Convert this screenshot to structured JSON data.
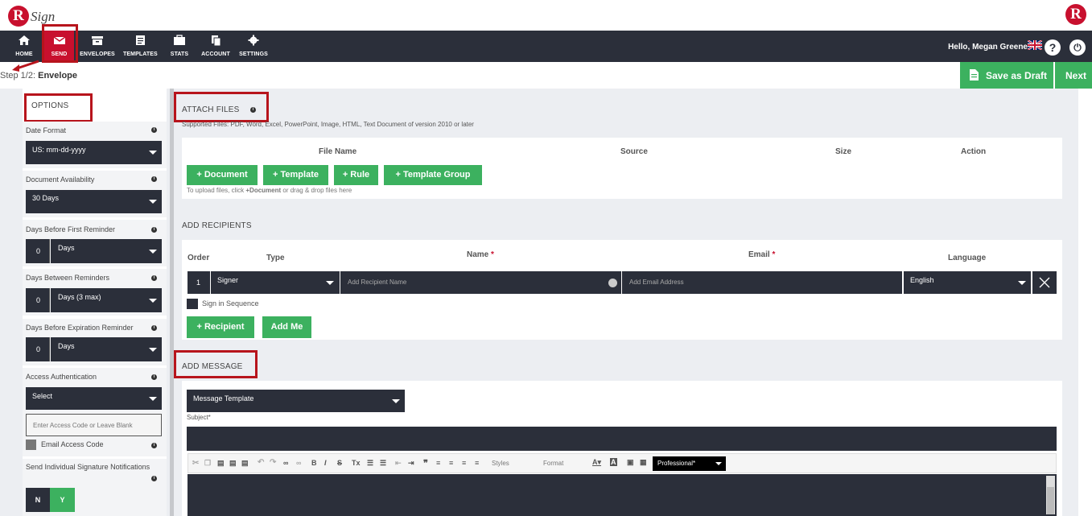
{
  "brand": {
    "logo_letter": "R",
    "logo_word": "Sign"
  },
  "nav": {
    "items": [
      {
        "label": "HOME",
        "icon": "home-icon"
      },
      {
        "label": "SEND",
        "icon": "envelope-icon"
      },
      {
        "label": "ENVELOPES",
        "icon": "envelopes-icon"
      },
      {
        "label": "TEMPLATES",
        "icon": "templates-icon"
      },
      {
        "label": "STATS",
        "icon": "stats-icon"
      },
      {
        "label": "ACCOUNT",
        "icon": "account-icon"
      },
      {
        "label": "SETTINGS",
        "icon": "gear-icon"
      }
    ],
    "greeting": "Hello, Megan Greene",
    "help": "?",
    "power": "⏻"
  },
  "subbar": {
    "step_prefix": "Step 1/2:",
    "step_name": "Envelope",
    "save_draft": "Save as Draft",
    "next": "Next"
  },
  "options": {
    "title": "OPTIONS",
    "date_format": {
      "label": "Date Format",
      "value": "US: mm-dd-yyyy"
    },
    "doc_availability": {
      "label": "Document Availability",
      "value": "30 Days"
    },
    "first_reminder": {
      "label": "Days Before First Reminder",
      "num": "0",
      "unit": "Days"
    },
    "between_reminders": {
      "label": "Days Between Reminders",
      "num": "0",
      "unit": "Days (3 max)"
    },
    "expiration_reminder": {
      "label": "Days Before Expiration Reminder",
      "num": "0",
      "unit": "Days"
    },
    "access_auth": {
      "label": "Access Authentication",
      "value": "Select",
      "placeholder": "Enter Access Code or Leave Blank",
      "email_code": "Email Access Code"
    },
    "individual": {
      "label": "Send Individual Signature Notifications",
      "no": "N",
      "yes": "Y"
    }
  },
  "attach": {
    "title": "ATTACH FILES",
    "supported": "Supported Files: PDF, Word, Excel, PowerPoint, Image, HTML, Text Document of version 2010 or later",
    "headers": {
      "file_name": "File Name",
      "source": "Source",
      "size": "Size",
      "action": "Action"
    },
    "buttons": {
      "document": "+ Document",
      "template": "+ Template",
      "rule": "+ Rule",
      "template_group": "+ Template Group"
    },
    "hint_prefix": "To upload files, click ",
    "hint_bold": "+Document",
    "hint_suffix": " or drag & drop files here"
  },
  "recipients": {
    "title": "ADD RECIPIENTS",
    "headers": {
      "order": "Order",
      "type": "Type",
      "name": "Name",
      "email": "Email",
      "language": "Language"
    },
    "required_mark": "*",
    "row": {
      "order": "1",
      "type": "Signer",
      "name_placeholder": "Add Recipient Name",
      "email_placeholder": "Add Email Address",
      "language": "English"
    },
    "sequence": "Sign in Sequence",
    "add_recipient": "+ Recipient",
    "add_me": "Add Me"
  },
  "message": {
    "title": "ADD MESSAGE",
    "template": "Message Template",
    "subject_label": "Subject*",
    "toolbar": {
      "styles": "Styles",
      "format": "Format",
      "font_select": "Professional*"
    }
  },
  "colors": {
    "brand_red": "#c8102e",
    "nav_dark": "#2b2f3a",
    "green": "#3cb15f"
  }
}
